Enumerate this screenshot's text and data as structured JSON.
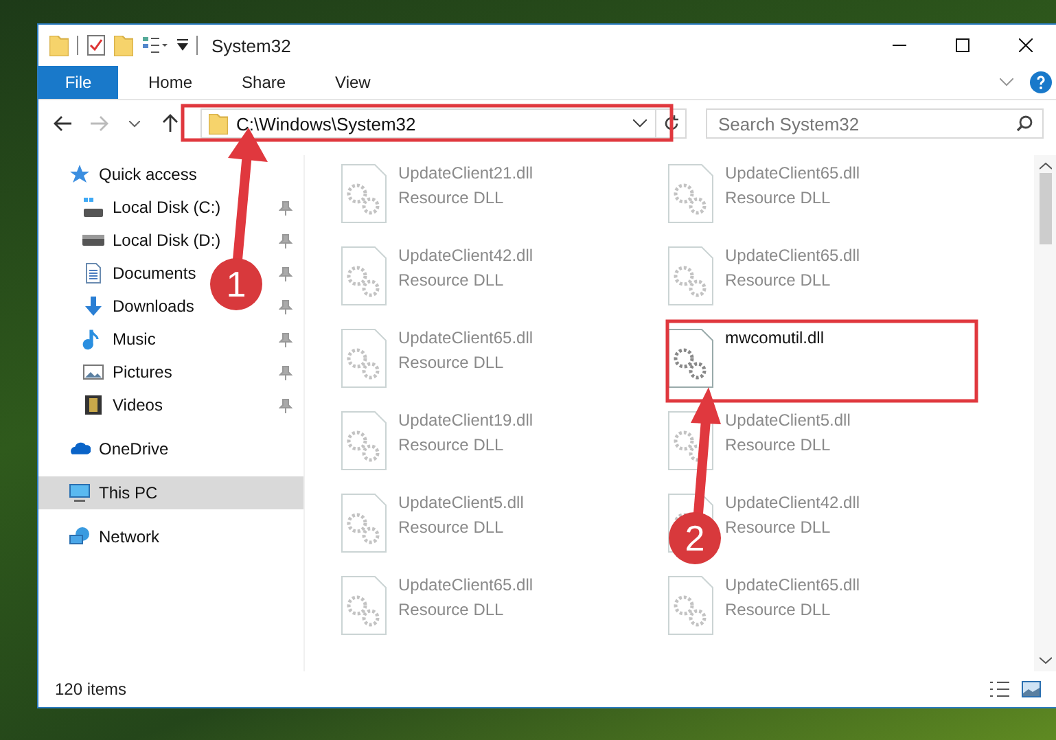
{
  "window": {
    "title": "System32"
  },
  "ribbon_tabs": [
    {
      "label": "File",
      "kind": "file"
    },
    {
      "label": "Home",
      "kind": "tab"
    },
    {
      "label": "Share",
      "kind": "tab"
    },
    {
      "label": "View",
      "kind": "tab"
    }
  ],
  "address_bar": {
    "path": "C:\\Windows\\System32"
  },
  "search": {
    "placeholder": "Search System32"
  },
  "sidebar": {
    "items": [
      {
        "label": "Quick access",
        "kind": "star",
        "selected": false,
        "children": [
          {
            "label": "Local Disk (C:)",
            "kind": "system-drive",
            "pinned": true,
            "selected": false
          },
          {
            "label": "Local Disk (D:)",
            "kind": "drive",
            "pinned": true,
            "selected": false
          },
          {
            "label": "Documents",
            "kind": "documents",
            "pinned": true,
            "selected": false
          },
          {
            "label": "Downloads",
            "kind": "downloads",
            "pinned": true,
            "selected": false
          },
          {
            "label": "Music",
            "kind": "music",
            "pinned": true,
            "selected": false
          },
          {
            "label": "Pictures",
            "kind": "pictures",
            "pinned": true,
            "selected": false
          },
          {
            "label": "Videos",
            "kind": "videos",
            "pinned": true,
            "selected": false
          }
        ]
      },
      {
        "label": "OneDrive",
        "kind": "cloud",
        "selected": false
      },
      {
        "label": "This PC",
        "kind": "computer",
        "selected": true
      },
      {
        "label": "Network",
        "kind": "network",
        "selected": false
      }
    ]
  },
  "files": [
    {
      "name": "UpdateClient21.dll",
      "type": "Resource DLL",
      "blurred": true
    },
    {
      "name": "UpdateClient65.dll",
      "type": "Resource DLL",
      "blurred": true
    },
    {
      "name": "UpdateClient42.dll",
      "type": "Resource DLL",
      "blurred": true
    },
    {
      "name": "UpdateClient65.dll",
      "type": "Resource DLL",
      "blurred": true
    },
    {
      "name": "UpdateClient65.dll",
      "type": "Resource DLL",
      "blurred": true
    },
    {
      "name": "mwcomutil.dll",
      "blurred": false
    },
    {
      "name": "UpdateClient19.dll",
      "type": "Resource DLL",
      "blurred": true
    },
    {
      "name": "UpdateClient5.dll",
      "type": "Resource DLL",
      "blurred": true
    },
    {
      "name": "UpdateClient5.dll",
      "type": "Resource DLL",
      "blurred": true
    },
    {
      "name": "UpdateClient42.dll",
      "type": "Resource DLL",
      "blurred": true
    },
    {
      "name": "UpdateClient65.dll",
      "type": "Resource DLL",
      "blurred": true
    },
    {
      "name": "UpdateClient65.dll",
      "type": "Resource DLL",
      "blurred": true
    }
  ],
  "status_bar": {
    "count": "120 items"
  },
  "annotations": [
    {
      "number": "1"
    },
    {
      "number": "2"
    }
  ]
}
